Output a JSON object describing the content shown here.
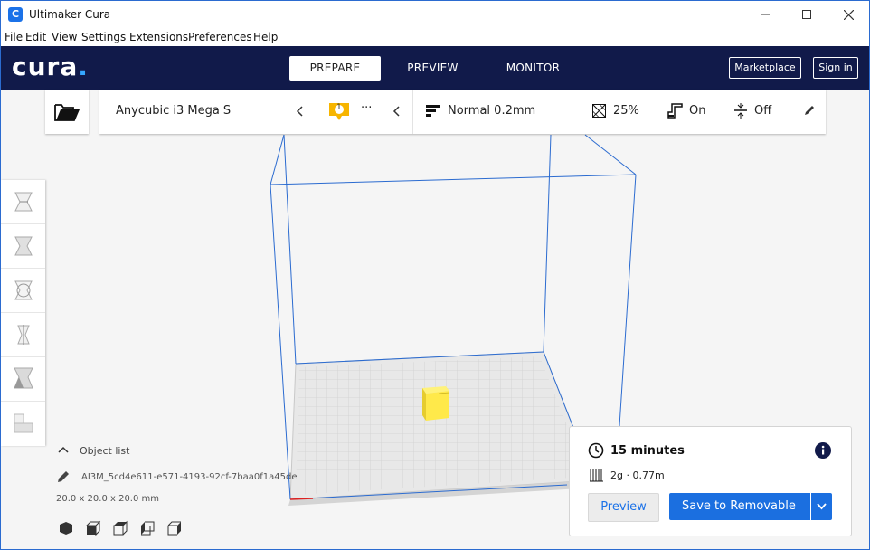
{
  "window": {
    "title": "Ultimaker Cura",
    "app_icon": "C"
  },
  "menu": [
    "File",
    "Edit",
    "View",
    "Settings",
    "Extensions",
    "Preferences",
    "Help"
  ],
  "header": {
    "logo": "cura",
    "logo_dot": ".",
    "tabs": [
      {
        "label": "PREPARE",
        "active": true
      },
      {
        "label": "PREVIEW",
        "active": false
      },
      {
        "label": "MONITOR",
        "active": false
      }
    ],
    "marketplace_label": "Marketplace",
    "signin_label": "Sign in"
  },
  "toolbar": {
    "printer_name": "Anycubic i3 Mega S",
    "extruder_badge": "1",
    "extruder_more": "···",
    "profile": "Normal 0.2mm",
    "infill": "25%",
    "support": "On",
    "adhesion": "Off"
  },
  "left_tools": [
    "move-tool-icon",
    "scale-tool-icon",
    "rotate-tool-icon",
    "mirror-tool-icon",
    "per-model-settings-icon",
    "support-blocker-icon"
  ],
  "object_list": {
    "label": "Object list",
    "object_name": "AI3M_5cd4e611-e571-4193-92cf-7baa0f1a45de",
    "dimensions": "20.0 x 20.0 x 20.0 mm"
  },
  "print_panel": {
    "time": "15 minutes",
    "material": "2g · 0.77m",
    "preview_label": "Preview",
    "save_label": "Save to Removable ..."
  },
  "colors": {
    "header": "#111a4a",
    "accent": "#1b6fe0",
    "model": "#ffe94a",
    "volume_lines": "#2b6bd0"
  }
}
